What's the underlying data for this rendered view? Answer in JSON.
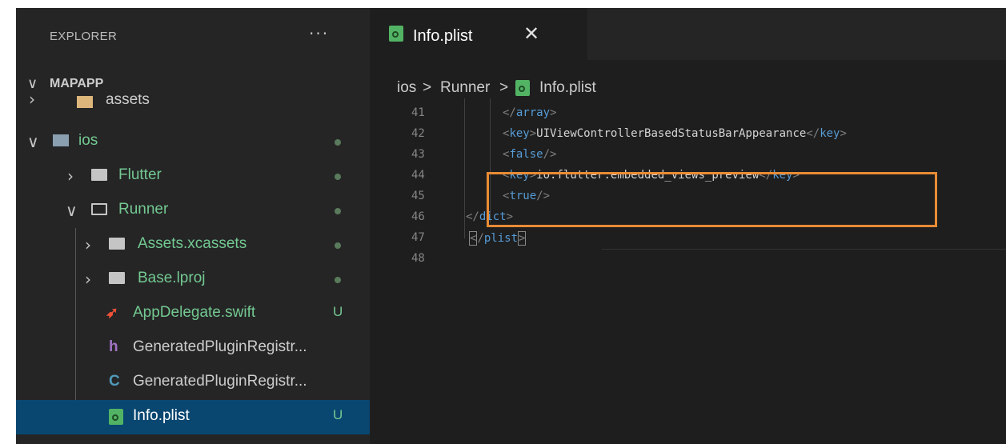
{
  "sidebar": {
    "title": "EXPLORER",
    "more_label": "···",
    "project": "MAPAPP",
    "items": [
      {
        "label": "assets",
        "badge": ""
      },
      {
        "label": "ios",
        "badge": ""
      },
      {
        "label": "Flutter",
        "badge": ""
      },
      {
        "label": "Runner",
        "badge": ""
      },
      {
        "label": "Assets.xcassets",
        "badge": ""
      },
      {
        "label": "Base.lproj",
        "badge": ""
      },
      {
        "label": "AppDelegate.swift",
        "badge": "U"
      },
      {
        "label": "GeneratedPluginRegistr...",
        "badge": ""
      },
      {
        "label": "GeneratedPluginRegistr...",
        "badge": ""
      },
      {
        "label": "Info.plist",
        "badge": "U"
      }
    ],
    "icons": {
      "h": "h",
      "c": "C"
    }
  },
  "tab": {
    "label": "Info.plist",
    "close": "✕"
  },
  "breadcrumb": {
    "a": "ios",
    "sep": ">",
    "b": "Runner",
    "c": "Info.plist"
  },
  "editor": {
    "line_numbers": [
      "41",
      "42",
      "43",
      "44",
      "45",
      "46",
      "47",
      "48"
    ],
    "lines": {
      "l41": {
        "open": "</",
        "tag": "array",
        "close": ">"
      },
      "l42": {
        "text": "UIViewControllerBasedStatusBarAppearance",
        "tag": "key"
      },
      "l43": {
        "tag": "false"
      },
      "l44": {
        "text": "io.flutter.embedded_views_preview",
        "tag": "key"
      },
      "l45": {
        "tag": "true"
      },
      "l46": {
        "tag": "dict"
      },
      "l47": {
        "tag": "plist"
      }
    }
  },
  "colors": {
    "highlight_border": "#e88b34",
    "selection": "#094771",
    "untracked": "#73c991"
  }
}
